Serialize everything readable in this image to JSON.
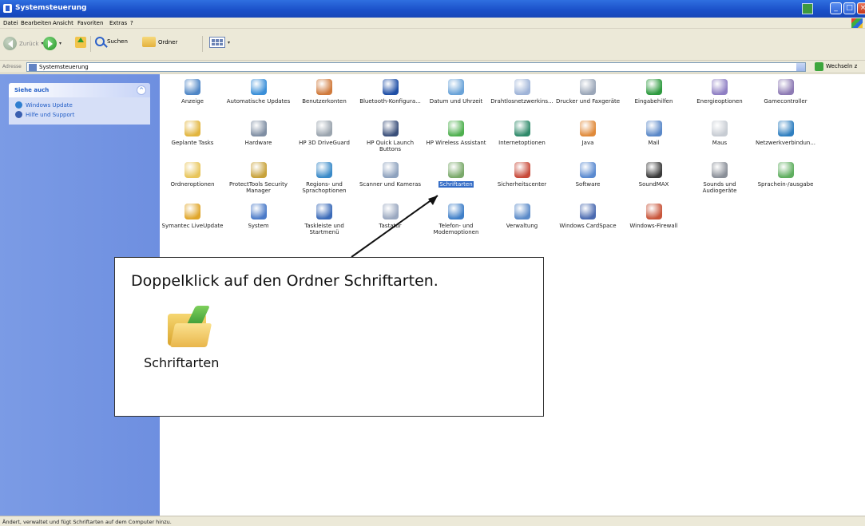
{
  "window": {
    "title": "Systemsteuerung"
  },
  "menu": [
    "Datei",
    "Bearbeiten",
    "Ansicht",
    "Favoriten",
    "Extras",
    "?"
  ],
  "toolbar": {
    "back_label": "Zurück",
    "search_label": "Suchen",
    "folders_label": "Ordner"
  },
  "address": {
    "label": "Adresse",
    "value": "Systemsteuerung",
    "go_label": "Wechseln z"
  },
  "sidebar": {
    "see_also_title": "Siehe auch",
    "links": [
      {
        "label": "Windows Update"
      },
      {
        "label": "Hilfe und Support"
      }
    ]
  },
  "items": [
    {
      "label": "Anzeige",
      "color": "#4f86c6"
    },
    {
      "label": "Automatische Updates",
      "color": "#3a8fd8"
    },
    {
      "label": "Benutzerkonten",
      "color": "#d07a3c"
    },
    {
      "label": "Bluetooth-Konfigura...",
      "color": "#1f4fa6"
    },
    {
      "label": "Datum und Uhrzeit",
      "color": "#6aa3d8"
    },
    {
      "label": "Drahtlosnetzwerkins...",
      "color": "#9fb4d8"
    },
    {
      "label": "Drucker und Faxgeräte",
      "color": "#9aa6b8"
    },
    {
      "label": "Eingabehilfen",
      "color": "#2e9a3f"
    },
    {
      "label": "Energieoptionen",
      "color": "#8f7fc4"
    },
    {
      "label": "Gamecontroller",
      "color": "#8d7ab4"
    },
    {
      "label": "Geplante Tasks",
      "color": "#e2b53e"
    },
    {
      "label": "Hardware",
      "color": "#7f8ea3"
    },
    {
      "label": "HP 3D DriveGuard",
      "color": "#9aa4ae"
    },
    {
      "label": "HP Quick Launch Buttons",
      "color": "#3a4f7a"
    },
    {
      "label": "HP Wireless Assistant",
      "color": "#4fb04f"
    },
    {
      "label": "Internetoptionen",
      "color": "#2f8a6a"
    },
    {
      "label": "Java",
      "color": "#e08a3a"
    },
    {
      "label": "Mail",
      "color": "#5a88c8"
    },
    {
      "label": "Maus",
      "color": "#c7ccd3"
    },
    {
      "label": "Netzwerkverbindun...",
      "color": "#2f7fc0"
    },
    {
      "label": "Ordneroptionen",
      "color": "#e8c55a"
    },
    {
      "label": "ProtectTools Security Manager",
      "color": "#c8a23a"
    },
    {
      "label": "Regions- und Sprachoptionen",
      "color": "#3a8ac8"
    },
    {
      "label": "Scanner und Kameras",
      "color": "#8ea2be"
    },
    {
      "label": "Schriftarten",
      "color": "#7aa96a"
    },
    {
      "label": "Sicherheitscenter",
      "color": "#c84a3a"
    },
    {
      "label": "Software",
      "color": "#5a8ad0"
    },
    {
      "label": "SoundMAX",
      "color": "#3a3a3a"
    },
    {
      "label": "Sounds und Audiogeräte",
      "color": "#8a8f98"
    },
    {
      "label": "Sprachein-/ausgabe",
      "color": "#5fae5f"
    },
    {
      "label": "Symantec LiveUpdate",
      "color": "#e0a62a"
    },
    {
      "label": "System",
      "color": "#4a7ac8"
    },
    {
      "label": "Taskleiste und Startmenü",
      "color": "#3a6ab8"
    },
    {
      "label": "Tastatur",
      "color": "#9aa8c0"
    },
    {
      "label": "Telefon- und Modemoptionen",
      "color": "#3f7fc8"
    },
    {
      "label": "Verwaltung",
      "color": "#5a8ac8"
    },
    {
      "label": "Windows CardSpace",
      "color": "#4a6ab0"
    },
    {
      "label": "Windows-Firewall",
      "color": "#c8553a"
    }
  ],
  "selected_item": "Schriftarten",
  "callout": {
    "text": "Doppelklick auf den Ordner Schriftarten.",
    "folder_label": "Schriftarten"
  },
  "status": {
    "text": "Ändert, verwaltet und fügt Schriftarten auf dem Computer hinzu."
  }
}
